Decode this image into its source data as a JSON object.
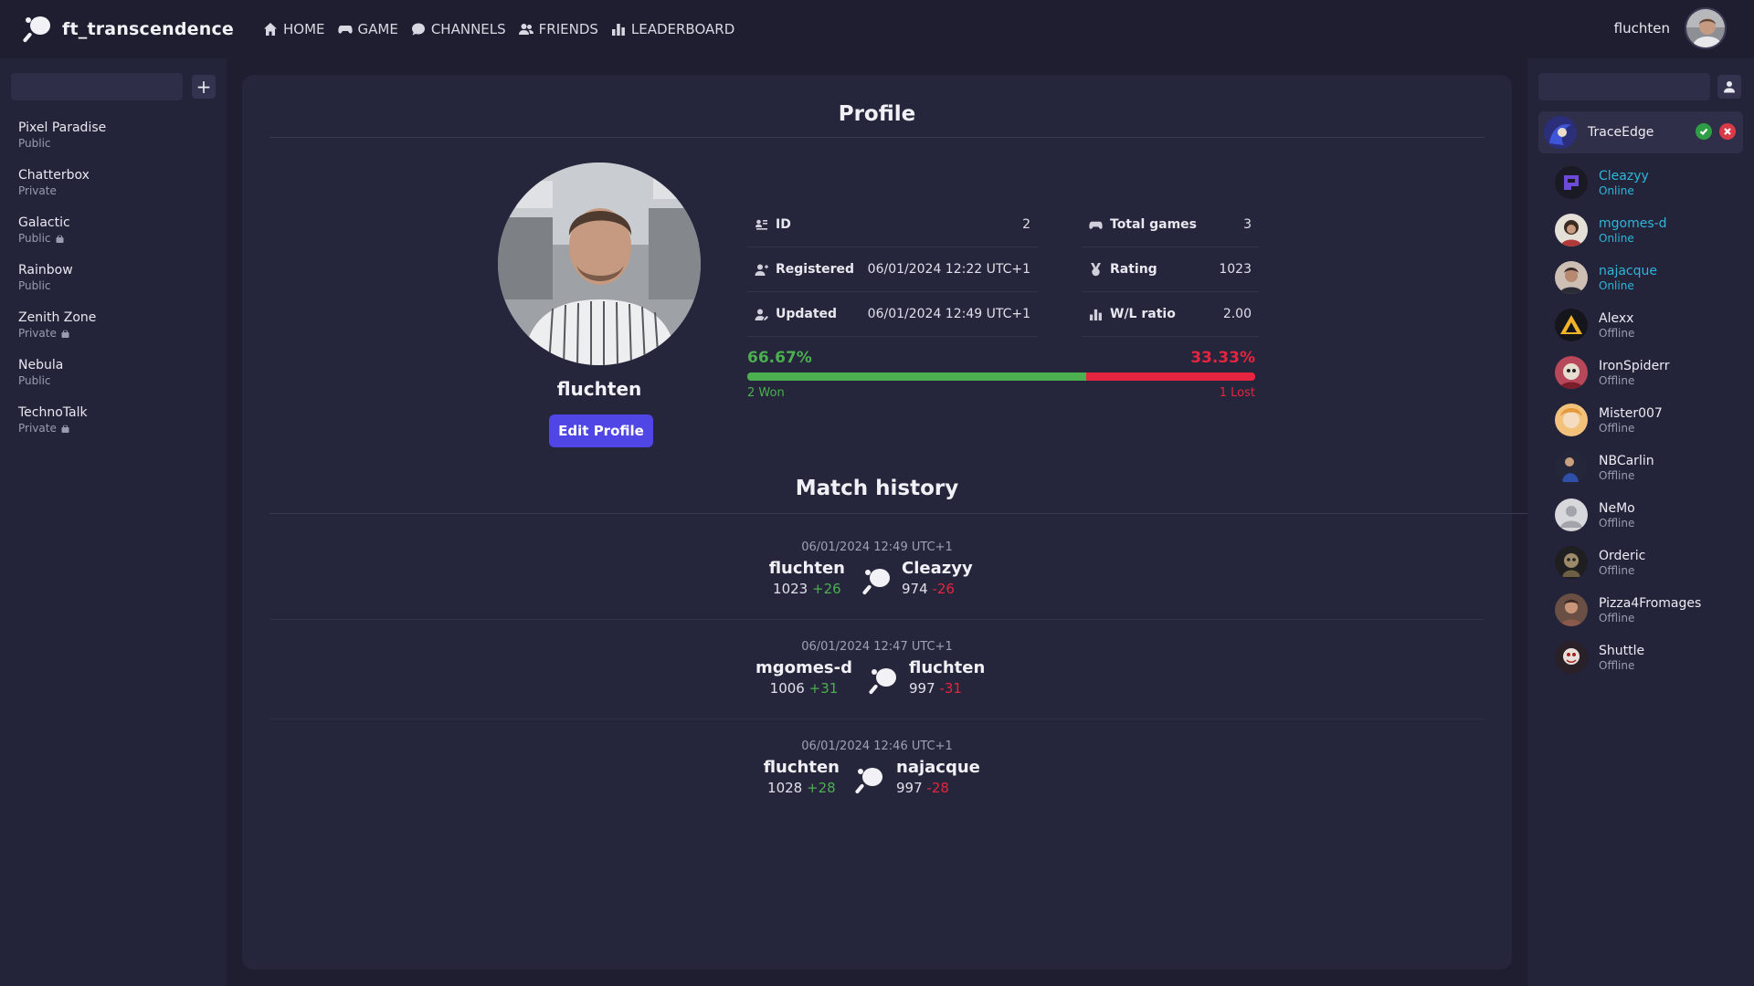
{
  "app": {
    "name": "ft_transcendence",
    "logo_icon": "ping-pong-paddle-icon"
  },
  "nav": [
    {
      "label": "HOME",
      "icon": "home-icon"
    },
    {
      "label": "GAME",
      "icon": "gamepad-icon"
    },
    {
      "label": "CHANNELS",
      "icon": "chat-bubble-icon"
    },
    {
      "label": "FRIENDS",
      "icon": "users-icon"
    },
    {
      "label": "LEADERBOARD",
      "icon": "bar-chart-icon"
    }
  ],
  "user": {
    "name": "fluchten"
  },
  "channels": {
    "search_placeholder": "",
    "items": [
      {
        "name": "Pixel Paradise",
        "type": "Public",
        "locked": false
      },
      {
        "name": "Chatterbox",
        "type": "Private",
        "locked": false
      },
      {
        "name": "Galactic",
        "type": "Public",
        "locked": true
      },
      {
        "name": "Rainbow",
        "type": "Public",
        "locked": false
      },
      {
        "name": "Zenith Zone",
        "type": "Private",
        "locked": true
      },
      {
        "name": "Nebula",
        "type": "Public",
        "locked": false
      },
      {
        "name": "TechnoTalk",
        "type": "Private",
        "locked": true
      }
    ]
  },
  "profile": {
    "title": "Profile",
    "username": "fluchten",
    "edit_label": "Edit Profile",
    "stats": {
      "id_label": "ID",
      "id_value": "2",
      "registered_label": "Registered",
      "registered_value": "06/01/2024 12:22 UTC+1",
      "updated_label": "Updated",
      "updated_value": "06/01/2024 12:49 UTC+1",
      "total_games_label": "Total games",
      "total_games_value": "3",
      "rating_label": "Rating",
      "rating_value": "1023",
      "wl_label": "W/L ratio",
      "wl_value": "2.00"
    },
    "ratio": {
      "win_pct": "66.67%",
      "loss_pct": "33.33%",
      "win_fraction": 0.6667,
      "won_label": "2 Won",
      "lost_label": "1 Lost"
    }
  },
  "match_history": {
    "title": "Match history",
    "matches": [
      {
        "date": "06/01/2024 12:49 UTC+1",
        "left": {
          "name": "fluchten",
          "rating": "1023",
          "delta": "+26"
        },
        "right": {
          "name": "Cleazyy",
          "rating": "974",
          "delta": "-26"
        }
      },
      {
        "date": "06/01/2024 12:47 UTC+1",
        "left": {
          "name": "mgomes-d",
          "rating": "1006",
          "delta": "+31"
        },
        "right": {
          "name": "fluchten",
          "rating": "997",
          "delta": "-31"
        }
      },
      {
        "date": "06/01/2024 12:46 UTC+1",
        "left": {
          "name": "fluchten",
          "rating": "1028",
          "delta": "+28"
        },
        "right": {
          "name": "najacque",
          "rating": "997",
          "delta": "-28"
        }
      }
    ]
  },
  "friends": {
    "search_placeholder": "",
    "request": {
      "name": "TraceEdge"
    },
    "items": [
      {
        "name": "Cleazyy",
        "status": "Online"
      },
      {
        "name": "mgomes-d",
        "status": "Online"
      },
      {
        "name": "najacque",
        "status": "Online"
      },
      {
        "name": "Alexx",
        "status": "Offline"
      },
      {
        "name": "IronSpiderr",
        "status": "Offline"
      },
      {
        "name": "Mister007",
        "status": "Offline"
      },
      {
        "name": "NBCarlin",
        "status": "Offline"
      },
      {
        "name": "NeMo",
        "status": "Offline"
      },
      {
        "name": "Orderic",
        "status": "Offline"
      },
      {
        "name": "Pizza4Fromages",
        "status": "Offline"
      },
      {
        "name": "Shuttle",
        "status": "Offline"
      }
    ]
  },
  "colors": {
    "win": "#4caf50",
    "loss": "#e5253f",
    "online": "#2fb6d8",
    "accent": "#4f46e5"
  }
}
